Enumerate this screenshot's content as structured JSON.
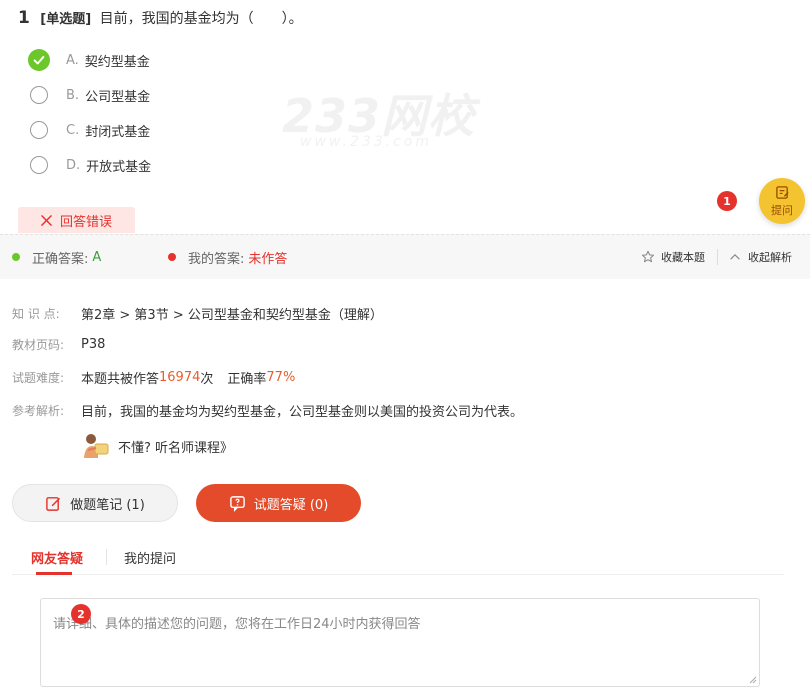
{
  "question": {
    "number": "1",
    "type_label": "[单选题]",
    "text": "目前，我国的基金均为（　　）。"
  },
  "options": [
    {
      "letter": "A.",
      "text": "契约型基金",
      "selected": true
    },
    {
      "letter": "B.",
      "text": "公司型基金",
      "selected": false
    },
    {
      "letter": "C.",
      "text": "封闭式基金",
      "selected": false
    },
    {
      "letter": "D.",
      "text": "开放式基金",
      "selected": false
    }
  ],
  "watermark": {
    "brand": "233网校",
    "url": "www.233.com"
  },
  "ask_button": {
    "label": "提问",
    "badge": "1"
  },
  "result_tag": {
    "label": "回答错误"
  },
  "answer_bar": {
    "correct_label": "正确答案:",
    "correct_value": "A",
    "mine_label": "我的答案:",
    "mine_value": "未作答",
    "favorite_label": "收藏本题",
    "collapse_label": "收起解析"
  },
  "analysis": {
    "knowledge_label": "知 识 点:",
    "knowledge_value": "第2章 > 第3节 > 公司型基金和契约型基金（理解）",
    "page_label": "教材页码:",
    "page_value": "P38",
    "difficulty_label": "试题难度:",
    "difficulty_prefix": "本题共被作答",
    "difficulty_count": "16974",
    "difficulty_times": "次",
    "accuracy_label": "正确率",
    "accuracy_value": "77%",
    "reference_label": "参考解析:",
    "reference_text": "目前，我国的基金均为契约型基金，公司型基金则以美国的投资公司为代表。",
    "course_link": "不懂? 听名师课程》"
  },
  "buttons": {
    "notes_label": "做题笔记 (1)",
    "qa_label": "试题答疑 (0)"
  },
  "tabs": [
    {
      "label": "网友答疑",
      "active": true
    },
    {
      "label": "我的提问",
      "active": false
    }
  ],
  "question_input": {
    "placeholder": "请详细、具体的描述您的问题，您将在工作日24小时内获得回答",
    "badge": "2"
  },
  "colors": {
    "correct_green": "#6cc72a",
    "error_red": "#e5322d",
    "accent_orange": "#e95d2c",
    "ask_yellow": "#f4c430"
  }
}
